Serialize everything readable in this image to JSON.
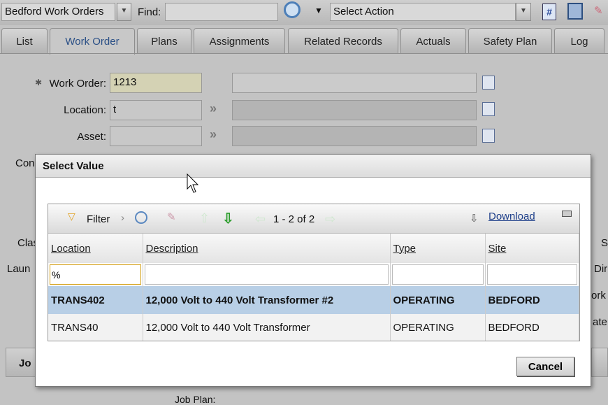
{
  "toolbar": {
    "app_select": "Bedford Work Orders",
    "find_label": "Find:",
    "find_value": "",
    "action_select": "Select Action"
  },
  "tabs": [
    "List",
    "Work Order",
    "Plans",
    "Assignments",
    "Related Records",
    "Actuals",
    "Safety Plan",
    "Log"
  ],
  "active_tab": "Work Order",
  "form": {
    "work_order_label": "Work Order:",
    "work_order_value": "1213",
    "location_label": "Location:",
    "location_value": "t",
    "asset_label": "Asset:",
    "asset_value": ""
  },
  "background_fragments": {
    "left": [
      "Con",
      "Clas",
      "Laun",
      "Jo"
    ],
    "right": [
      "S",
      "Dir",
      "ork",
      "ate"
    ],
    "job_plan": "Job Plan:"
  },
  "dialog": {
    "title": "Select Value",
    "filter_label": "Filter",
    "pagination": "1 - 2 of 2",
    "download_label": "Download",
    "columns": [
      "Location",
      "Description",
      "Type",
      "Site"
    ],
    "filter_values": [
      "%",
      "",
      "",
      ""
    ],
    "rows": [
      [
        "TRANS402",
        "12,000 Volt to 440 Volt Transformer #2",
        "OPERATING",
        "BEDFORD"
      ],
      [
        "TRANS40",
        "12,000 Volt to 440 Volt Transformer",
        "OPERATING",
        "BEDFORD"
      ]
    ],
    "selected_row": 0,
    "cancel_label": "Cancel"
  },
  "colors": {
    "selected_row": "#b8cfe6",
    "active_tab_text": "#2a4f86"
  }
}
